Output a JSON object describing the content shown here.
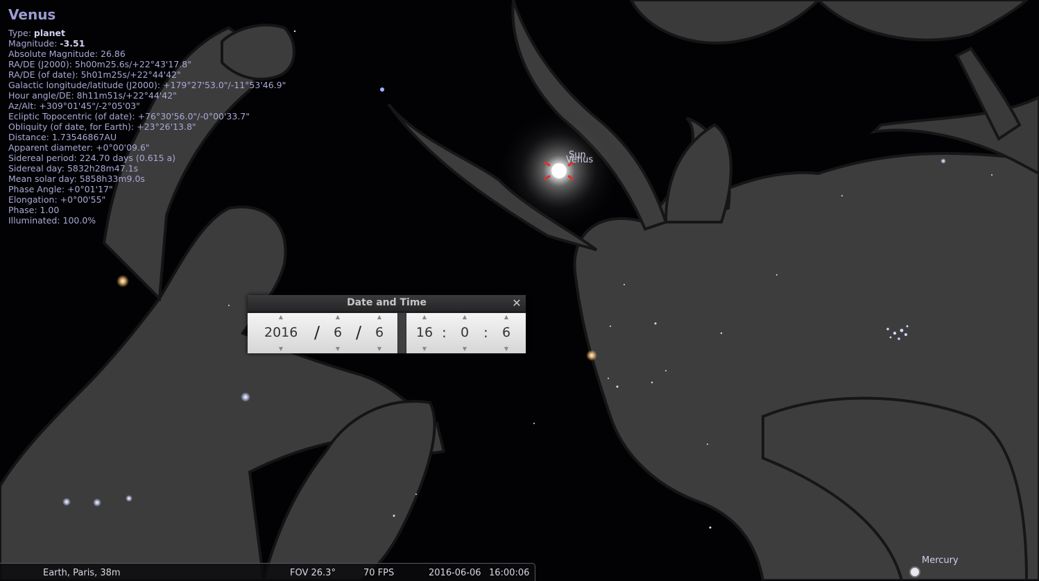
{
  "object_info": {
    "name": "Venus",
    "type_label": "Type:",
    "type_value": "planet",
    "magnitude_label": "Magnitude:",
    "magnitude_value": "-3.51",
    "rows": [
      "Absolute Magnitude: 26.86",
      "RA/DE (J2000): 5h00m25.6s/+22°43'17.8\"",
      "RA/DE (of date): 5h01m25s/+22°44'42\"",
      "Galactic longitude/latitude (J2000): +179°27'53.0\"/-11°53'46.9\"",
      "Hour angle/DE: 8h11m51s/+22°44'42\"",
      "Az/Alt: +309°01'45\"/-2°05'03\"",
      "Ecliptic Topocentric (of date): +76°30'56.0\"/-0°00'33.7\"",
      "Obliquity (of date, for Earth): +23°26'13.8\"",
      "Distance: 1.73546867AU",
      "Apparent diameter: +0°00'09.6\"",
      "Sidereal period: 224.70 days (0.615 a)",
      "Sidereal day: 5832h28m47.1s",
      "Mean solar day: 5858h33m9.0s",
      "Phase Angle: +0°01'17\"",
      "Elongation: +0°00'55\"",
      "Phase: 1.00",
      "Illuminated: 100.0%"
    ]
  },
  "sky_labels": {
    "sun": "Sun",
    "venus": "Venus",
    "mercury": "Mercury"
  },
  "datetime_dialog": {
    "title": "Date and Time",
    "close_icon": "close-icon",
    "year": "2016",
    "month": "6",
    "day": "6",
    "hour": "16",
    "minute": "0",
    "second": "6",
    "date_separator": "/",
    "time_separator": ":"
  },
  "bottom_bar": {
    "location": "Earth, Paris, 38m",
    "fov": "FOV 26.3°",
    "fps": "70 FPS",
    "date": "2016-06-06",
    "time": "16:00:06"
  },
  "colors": {
    "sky_background": "#020204",
    "info_text": "#a9a9d6",
    "selection_marker": "#e0302a",
    "constellation_art": "#3a3a3a"
  }
}
